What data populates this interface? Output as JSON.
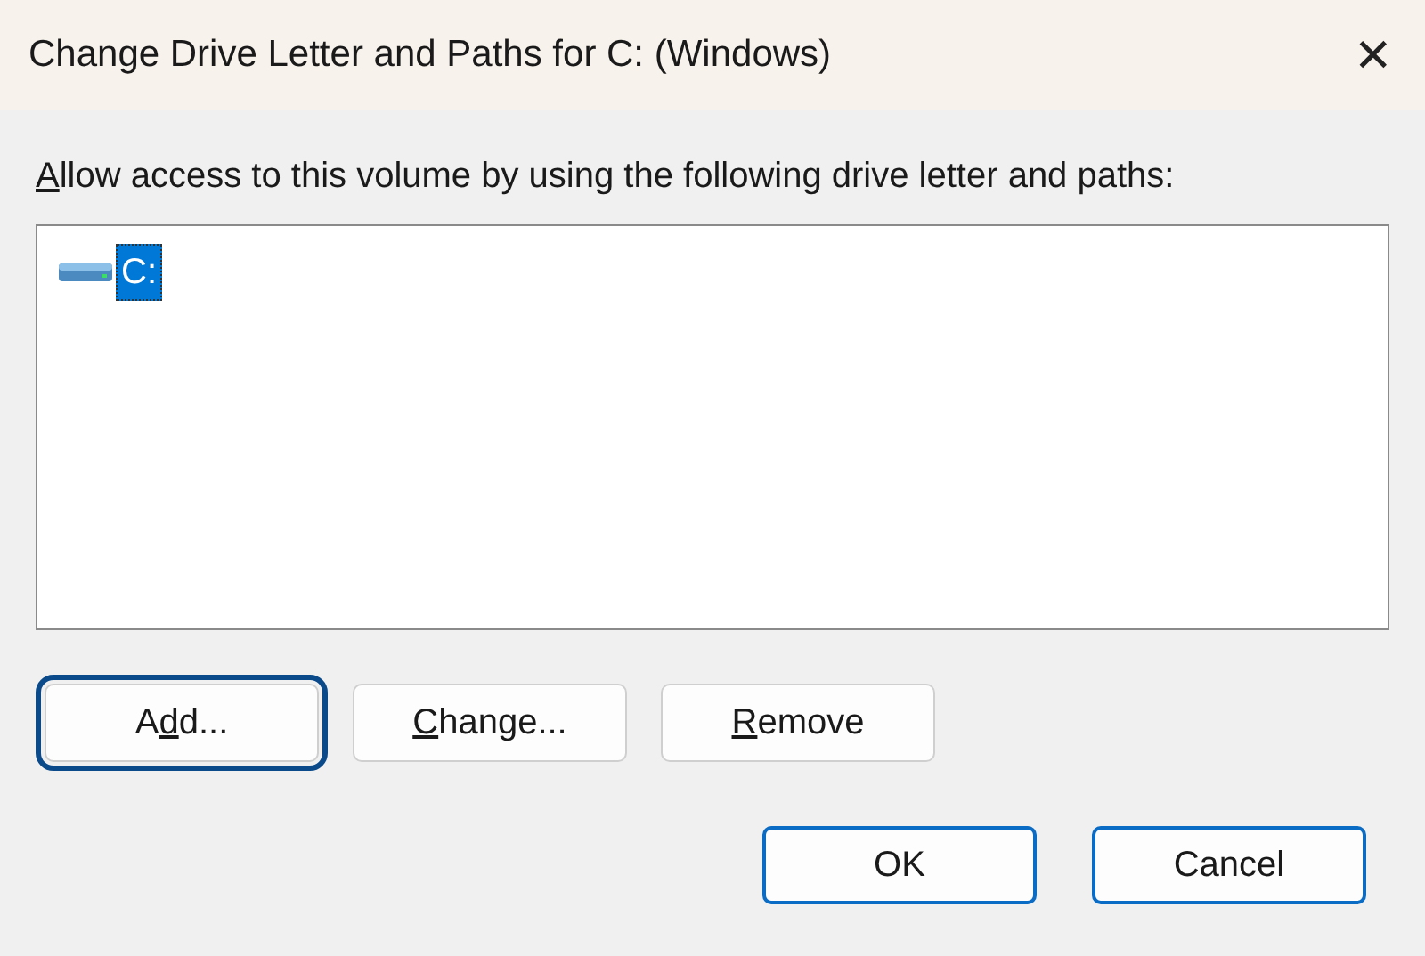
{
  "window": {
    "title": "Change Drive Letter and Paths for C: (Windows)",
    "close": "✕"
  },
  "prompt": {
    "parts": {
      "key": "A",
      "post": "llow access to this volume by using the following drive letter and paths:"
    }
  },
  "list": {
    "items": [
      {
        "label": "C:",
        "selected": true
      }
    ]
  },
  "actions": [
    {
      "parts": {
        "pre": "A",
        "key": "d",
        "post": "d..."
      },
      "focused": true
    },
    {
      "parts": {
        "key": "C",
        "post": "hange..."
      },
      "focused": false
    },
    {
      "parts": {
        "key": "R",
        "post": "emove"
      },
      "focused": false
    }
  ],
  "footer": [
    {
      "parts": {
        "pre": "OK"
      },
      "default": true
    },
    {
      "parts": {
        "pre": "Cancel"
      },
      "default": true
    }
  ]
}
